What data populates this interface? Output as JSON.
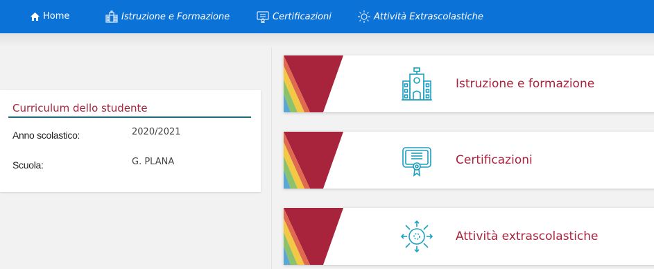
{
  "nav": {
    "home": "Home",
    "istruzione": "Istruzione e Formazione",
    "certificazioni": "Certificazioni",
    "attivita": "Attività Extrascolastiche"
  },
  "student": {
    "title": "Curriculum dello studente",
    "anno_label": "Anno scolastico:",
    "anno_value": "2020/2021",
    "scuola_label": "Scuola:",
    "scuola_value": "G. PLANA"
  },
  "cards": [
    {
      "title": "Istruzione e formazione",
      "icon": "school-building-icon"
    },
    {
      "title": "Certificazioni",
      "icon": "certificate-icon"
    },
    {
      "title": "Attività extrascolastiche",
      "icon": "activity-sun-icon"
    }
  ],
  "colors": {
    "topbar": "#0b72d8",
    "accent": "#a8233c",
    "icon": "#1aa0c0",
    "underline": "#1d6b78",
    "stripe": [
      "#b52f43",
      "#e06a4f",
      "#f3c845",
      "#8cc26b",
      "#5aa7d6"
    ]
  }
}
